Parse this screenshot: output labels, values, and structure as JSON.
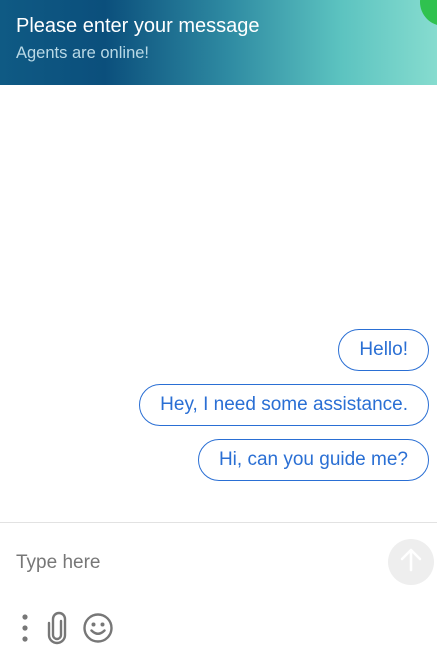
{
  "header": {
    "title": "Please enter your message",
    "subtitle": "Agents are online!",
    "status_color": "#2fc24f"
  },
  "messages": [
    {
      "text": "Hello!"
    },
    {
      "text": "Hey, I need some assistance."
    },
    {
      "text": "Hi, can you guide me?"
    }
  ],
  "composer": {
    "placeholder": "Type here",
    "value": "",
    "send_icon": "arrow-up-icon",
    "tools": [
      "more-options-icon",
      "paperclip-icon",
      "emoji-icon"
    ]
  },
  "colors": {
    "accent": "#2a6fd4",
    "header_gradient": [
      "#0f5a84",
      "#86dccf"
    ]
  }
}
